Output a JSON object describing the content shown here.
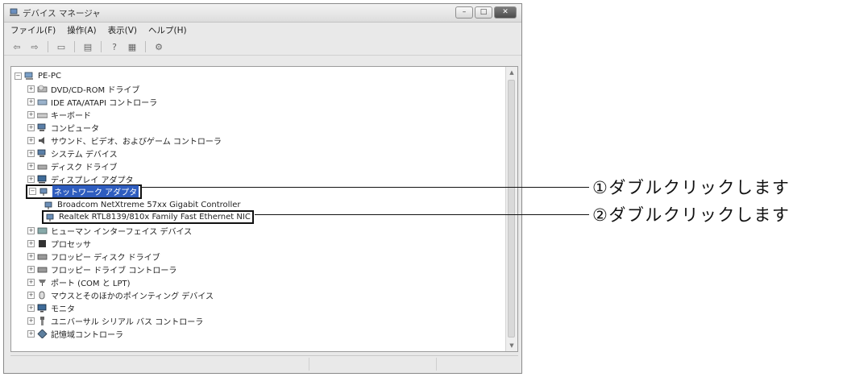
{
  "window": {
    "title": "デバイス マネージャ",
    "buttons": {
      "minimize": "–",
      "maximize": "□",
      "close": "✕"
    }
  },
  "menu": [
    "ファイル(F)",
    "操作(A)",
    "表示(V)",
    "ヘルプ(H)"
  ],
  "toolbar_icons": [
    "back-icon",
    "forward-icon",
    "view-icon",
    "properties-icon",
    "help-icon",
    "device-view-icon",
    "scan-hardware-icon"
  ],
  "tree": {
    "root": "PE-PC",
    "items": [
      "DVD/CD-ROM ドライブ",
      "IDE ATA/ATAPI コントローラ",
      "キーボード",
      "コンピュータ",
      "サウンド、ビデオ、およびゲーム コントローラ",
      "システム デバイス",
      "ディスク ドライブ",
      "ディスプレイ アダプタ",
      "ネットワーク アダプタ",
      "Broadcom NetXtreme 57xx Gigabit Controller",
      "Realtek RTL8139/810x Family Fast Ethernet NIC",
      "ヒューマン インターフェイス デバイス",
      "プロセッサ",
      "フロッピー ディスク ドライブ",
      "フロッピー ドライブ コントローラ",
      "ポート (COM と LPT)",
      "マウスとそのほかのポインティング デバイス",
      "モニタ",
      "ユニバーサル シリアル バス コントローラ",
      "記憶域コントローラ"
    ]
  },
  "annotations": [
    "①ダブルクリックします",
    "②ダブルクリックします"
  ],
  "colors": {
    "selection": "#2f5dbf",
    "annotation": "#111111"
  }
}
